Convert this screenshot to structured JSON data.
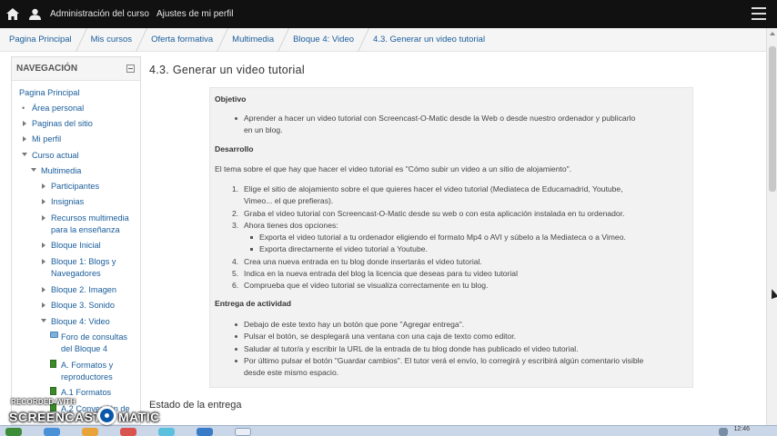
{
  "navbar": {
    "links": [
      "Administración del curso",
      "Ajustes de mi perfil"
    ]
  },
  "breadcrumb": [
    "Pagina Principal",
    "Mis cursos",
    "Oferta formativa",
    "Multimedia",
    "Bloque 4: Video",
    "4.3. Generar un video tutorial"
  ],
  "sidebar": {
    "title": "NAVEGACIÓN",
    "items": [
      "Pagina Principal",
      "Área personal",
      "Paginas del sitio",
      "Mi perfil",
      "Curso actual",
      "Multimedia",
      "Participantes",
      "Insignias",
      "Recursos multimedia",
      "para la enseñanza",
      "Bloque Inicial",
      "Bloque 1: Blogs y",
      "Navegadores",
      "Bloque 2. Imagen",
      "Bloque 3. Sonido",
      "Bloque 4: Video",
      "Foro de consultas",
      "del Bloque 4",
      "A. Formatos y",
      "reproductores",
      "A.1 Formatos",
      "A.2 Conversión de"
    ]
  },
  "main": {
    "title": "4.3. Generar un video tutorial",
    "objetivo_head": "Objetivo",
    "objetivo_item_1": "Aprender a hacer un video tutorial con Screencast-O-Matic desde la Web o desde nuestro ordenador y publicarlo",
    "objetivo_item_2": "en un blog.",
    "desarrollo_head": "Desarrollo",
    "desarrollo_intro": "El tema sobre el que hay que hacer el video tutorial es \"Cómo subir un video a un sitio de alojamiento\".",
    "steps": [
      "Elige el sitio de alojamiento sobre el que quieres hacer el video tutorial (Mediateca de Educamadrid, Youtube,",
      "Vimeo... el que prefieras).",
      "Graba el video tutorial con Screencast-O-Matic desde su web o con esta aplicación instalada en tu ordenador.",
      "Ahora tienes dos opciones:",
      "Exporta el video tutorial a tu ordenador eligiendo el formato Mp4 o AVI y súbelo a la Mediateca o a Vimeo.",
      "Exporta directamente el video tutorial a Youtube.",
      "Crea una nueva entrada en tu blog donde insertarás el video tutorial.",
      "Indica en la nueva entrada del blog la licencia que deseas para tu video tutorial",
      "Comprueba que el video tutorial se visualiza correctamente en tu blog."
    ],
    "step_numbers": [
      "1.",
      "2.",
      "3.",
      "4.",
      "5.",
      "6."
    ],
    "entrega_head": "Entrega de actividad",
    "entrega": [
      "Debajo de este texto hay un botón que pone \"Agregar entrega\".",
      "Pulsar el botón, se desplegará una ventana con una caja de texto como editor.",
      "Saludar al tutor/a y escribir la URL de la entrada de tu blog donde has publicado el video tutorial.",
      "Por último pulsar el botón \"Guardar cambios\". El tutor verá el envío, lo corregirá y escribirá algún comentario visible",
      "desde este mismo espacio."
    ],
    "estado": "Estado de la entrega"
  },
  "watermark": {
    "small": "RECORDED WITH",
    "big_left": "SCREENCAST",
    "big_right": "MATIC"
  },
  "taskbar": {
    "clock": "12:46"
  }
}
